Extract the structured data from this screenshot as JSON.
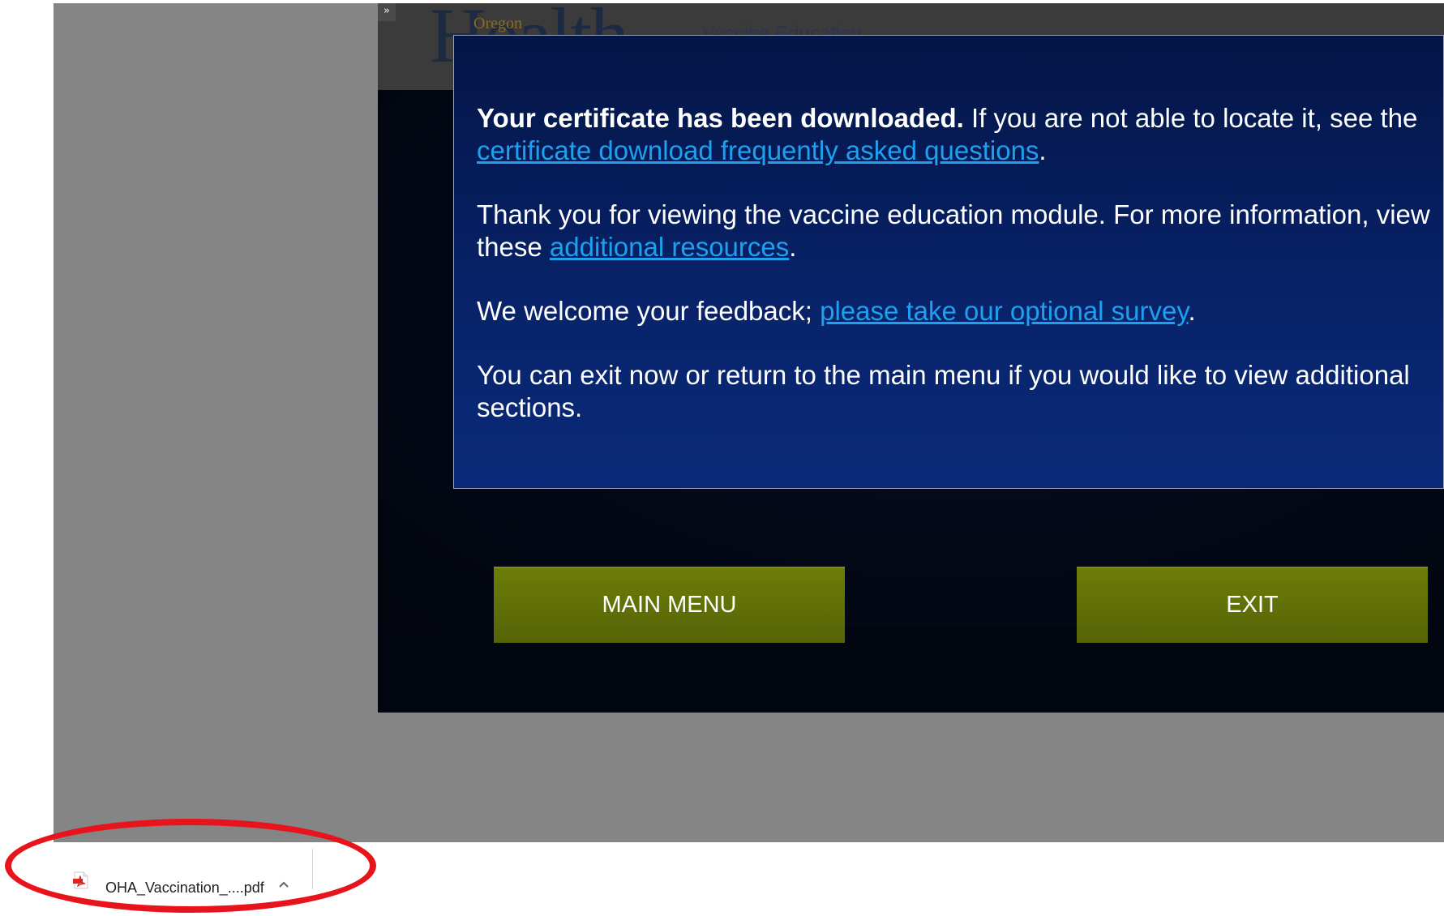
{
  "player": {
    "sidebar_toggle": "»",
    "header_logo_text": "Health",
    "header_logo_small": "Oregon",
    "header_subtitle": "Vaccine Education"
  },
  "modal": {
    "para1_bold": "Your certificate has been downloaded.",
    "para1_text": " If you are not able to locate it, see the ",
    "para1_link": "certificate download frequently asked questions",
    "para1_end": ".",
    "para2_text": "Thank you for viewing the vaccine education module.  For more information, view these ",
    "para2_link": "additional resources",
    "para2_end": ".",
    "para3_text": "We welcome your feedback; ",
    "para3_link": "please take our optional survey",
    "para3_end": ".",
    "para4_text": "You can exit now or return to the main menu if you would like to view additional sections."
  },
  "buttons": {
    "main_menu": "MAIN MENU",
    "exit": "EXIT"
  },
  "download_shelf": {
    "filename": "OHA_Vaccination_....pdf",
    "file_icon": "pdf-file-icon",
    "chevron_icon": "chevron-up-icon"
  },
  "colors": {
    "modal_bg": "#08236a",
    "link": "#1ea0ee",
    "button_bg": "#5f6f07",
    "annotation": "#e8141c"
  }
}
